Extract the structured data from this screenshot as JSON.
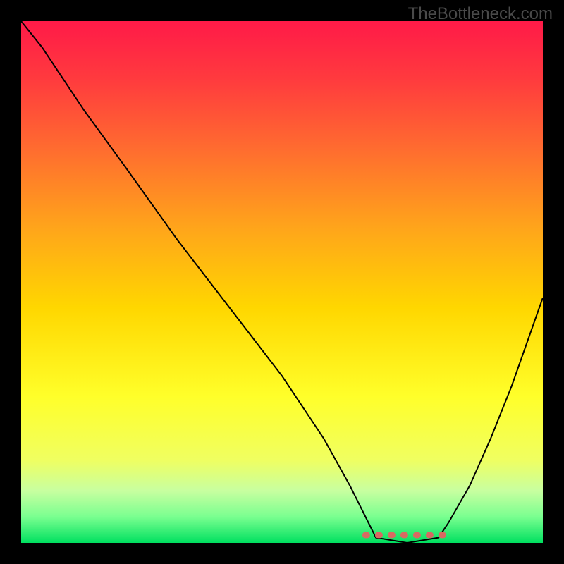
{
  "watermark": "TheBottleneck.com",
  "chart_data": {
    "type": "line",
    "title": "",
    "xlabel": "",
    "ylabel": "",
    "xlim": [
      0,
      100
    ],
    "ylim": [
      0,
      100
    ],
    "grid": false,
    "legend": false,
    "description": "Bottleneck-percentage style curve: steep decline from upper-left, flat optimum region around x≈68–80, rising again toward right edge. Background gradient encodes bottleneck severity (red=high, green=optimal).",
    "series": [
      {
        "name": "curve",
        "x": [
          0,
          4,
          8,
          12,
          20,
          30,
          40,
          50,
          58,
          63,
          66,
          68,
          74,
          80,
          82,
          86,
          90,
          94,
          100
        ],
        "y": [
          100,
          95,
          89,
          83,
          72,
          58,
          45,
          32,
          20,
          11,
          5,
          1,
          0,
          1,
          4,
          11,
          20,
          30,
          47
        ]
      }
    ],
    "flat_band": {
      "x_start": 66,
      "x_end": 82,
      "y": 1.5
    }
  },
  "colors": {
    "curve": "#000000",
    "flat_marker": "#d86a62",
    "bg_top": "#ff1a48",
    "bg_bottom": "#00e060",
    "frame": "#000000"
  }
}
